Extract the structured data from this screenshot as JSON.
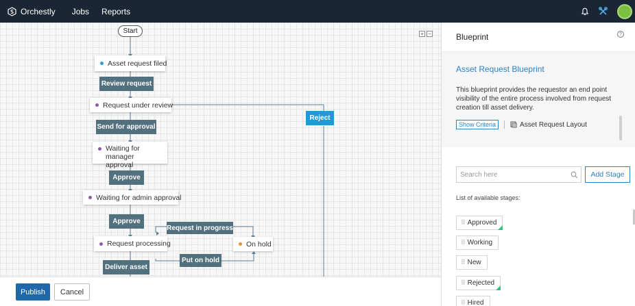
{
  "app": {
    "brand": "Orchestly",
    "nav": [
      {
        "label": "Jobs"
      },
      {
        "label": "Reports"
      }
    ]
  },
  "canvas": {
    "zoom_in": "+",
    "zoom_out": "−",
    "start_label": "Start",
    "states": {
      "asset_request_filed": {
        "label": "Asset request filed",
        "dot_color": "#2a9bd6"
      },
      "request_under_review": {
        "label": "Request under review",
        "dot_color": "#8e5aa8"
      },
      "waiting_manager": {
        "label": "Waiting for manager approval",
        "dot_color": "#8e5aa8"
      },
      "waiting_admin": {
        "label": "Waiting for admin approval",
        "dot_color": "#8e5aa8"
      },
      "request_processing": {
        "label": "Request processing",
        "dot_color": "#8e5aa8"
      },
      "on_hold": {
        "label": "On hold",
        "dot_color": "#f0932b"
      }
    },
    "transitions": {
      "review_request": "Review request",
      "send_for_approval": "Send for approval",
      "approve_1": "Approve",
      "approve_2": "Approve",
      "deliver_asset": "Deliver asset",
      "request_in_progress": "Request in progress",
      "put_on_hold": "Put on hold",
      "reject": "Reject"
    }
  },
  "footer": {
    "publish_label": "Publish",
    "cancel_label": "Cancel"
  },
  "panel": {
    "title": "Blueprint",
    "help": "?",
    "blueprint_name": "Asset Request Blueprint",
    "description": "This blueprint provides the requestor an end point visibility of the entire process involved from request creation till asset delivery.",
    "show_criteria": "Show Criteria",
    "layout_name": "Asset Request Layout",
    "search_placeholder": "Search here",
    "add_stage": "Add Stage",
    "list_label": "List of available stages:",
    "stages": [
      {
        "label": "Approved"
      },
      {
        "label": "Working"
      },
      {
        "label": "New"
      },
      {
        "label": "Rejected"
      },
      {
        "label": "Hired"
      }
    ]
  },
  "colors": {
    "topbar": "#1b2634",
    "transition": "#52707d",
    "reject": "#1e9ad6",
    "accent": "#2f80bf",
    "publish": "#1f67a8"
  }
}
